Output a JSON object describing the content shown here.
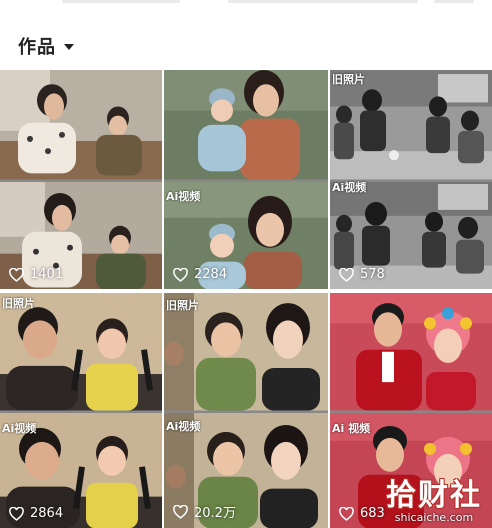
{
  "section": {
    "title": "作品"
  },
  "tiles": [
    {
      "tag_top": "",
      "tag_bottom": "",
      "likes": "1401"
    },
    {
      "tag_top": "",
      "tag_bottom": "Ai视频",
      "likes": "2284"
    },
    {
      "tag_top": "旧照片",
      "tag_bottom": "Ai视频",
      "likes": "578"
    },
    {
      "tag_top": "旧照片",
      "tag_bottom": "Ai视频",
      "likes": "2864"
    },
    {
      "tag_top": "旧照片",
      "tag_bottom": "Ai视频",
      "likes": "20.2万"
    },
    {
      "tag_top": "",
      "tag_bottom": "Ai 视频",
      "likes": "683"
    }
  ],
  "watermark": {
    "logo": "拾财社",
    "url": "shicaiche.com"
  },
  "colors": {
    "heart": "#ffffff",
    "watermark_outline": "#b6302a"
  }
}
